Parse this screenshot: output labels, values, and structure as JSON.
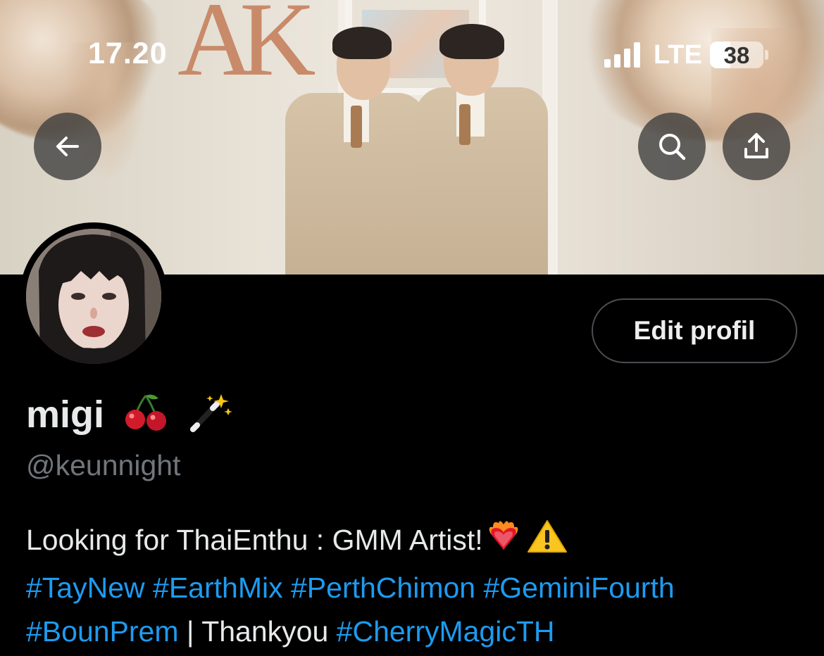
{
  "status_bar": {
    "time": "17.20",
    "network": "LTE",
    "battery": "38",
    "battery_level": 0.38
  },
  "header": {
    "back_icon": "arrow-left-icon",
    "search_icon": "search-icon",
    "share_icon": "share-icon"
  },
  "profile": {
    "display_name": "migi",
    "name_emojis": [
      "cherries-icon",
      "magic-wand-icon"
    ],
    "handle": "@keunnight",
    "edit_button_label": "Edit profil",
    "bio": {
      "line1_text": "Looking for ThaiEnthu : GMM Artist!",
      "line1_emojis": [
        "heart-on-fire-icon",
        "warning-icon"
      ],
      "tags_line2": [
        "#TayNew",
        "#EarthMix",
        "#PerthChimon",
        "#GeminiFourth"
      ],
      "tag_line3_first": "#BounPrem",
      "separator_text": " | Thankyou ",
      "tag_line3_last": "#CherryMagicTH"
    }
  },
  "colors": {
    "background": "#000000",
    "text_primary": "#e7e9ea",
    "text_secondary": "#71767b",
    "link": "#1d9bf0",
    "button_border": "#4a4e52"
  }
}
